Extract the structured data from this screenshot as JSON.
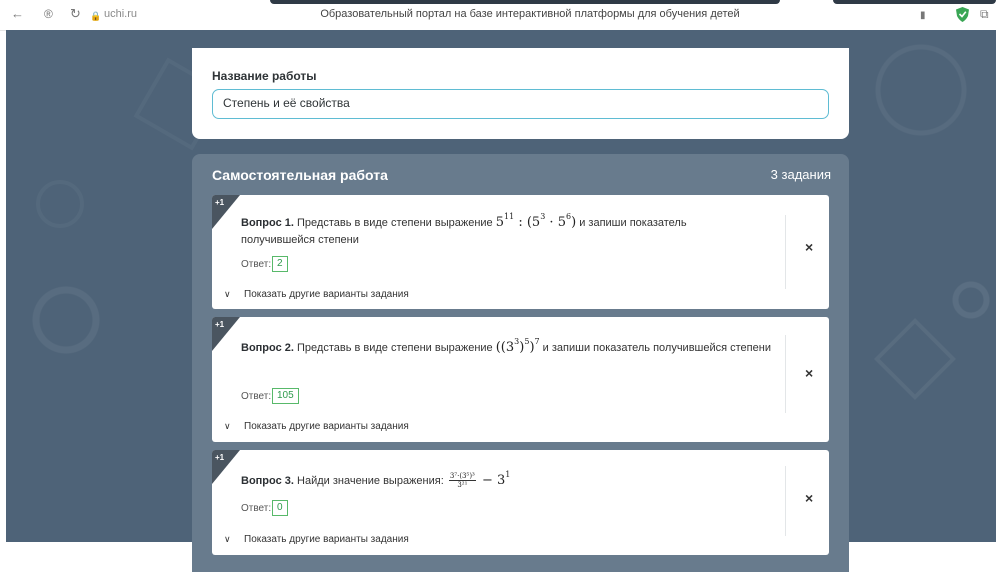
{
  "browser": {
    "back_icon": "←",
    "yandex_icon": "®",
    "reload_icon": "↻",
    "lock_icon": "🔒",
    "url": "uchi.ru",
    "title": "Образовательный портал на базе интерактивной платформы для обучения детей",
    "bookmark_icon": "▮",
    "ext_icon": "⧉"
  },
  "work": {
    "name_label": "Название работы",
    "name_value": "Степень и её свойства"
  },
  "panel": {
    "title": "Самостоятельная работа",
    "count": "3 задания"
  },
  "questions": [
    {
      "badge": "+1",
      "number": "Вопрос 1.",
      "text_before": "Представь в виде степени выражение",
      "expr": {
        "a": "5",
        "a_exp": "11",
        "op": " : (",
        "b": "5",
        "b_exp": "3",
        "dot": " · ",
        "c": "5",
        "c_exp": "6",
        "close": ")"
      },
      "text_after": "и запиши показатель получившейся степени",
      "answer_label": "Ответ:",
      "answer": "2",
      "show_more": "Показать другие варианты задания",
      "close": "×"
    },
    {
      "badge": "+1",
      "number": "Вопрос 2.",
      "text_before": "Представь в виде степени выражение",
      "expr": {
        "open": "((",
        "base": "3",
        "base_exp": "3",
        "mid": ")",
        "mid_exp": "5",
        "end": ")",
        "end_exp": "7"
      },
      "text_after": "и запиши показатель получившейся степени",
      "answer_label": "Ответ:",
      "answer": "105",
      "show_more": "Показать другие варианты задания",
      "close": "×"
    },
    {
      "badge": "+1",
      "number": "Вопрос 3.",
      "text_before": "Найди значение выражения:",
      "expr": {
        "num": "3⁷·(3⁵)³",
        "den": "3²¹",
        "rest": " − 3",
        "rest_exp": "1"
      },
      "answer_label": "Ответ:",
      "answer": "0",
      "show_more": "Показать другие варианты задания",
      "close": "×"
    }
  ],
  "colors": {
    "page_bg": "#4e6378",
    "panel_bg": "#687b8d",
    "input_border": "#5fbcd3",
    "answer_border": "#58b96a",
    "shield_green": "#3aa655"
  }
}
